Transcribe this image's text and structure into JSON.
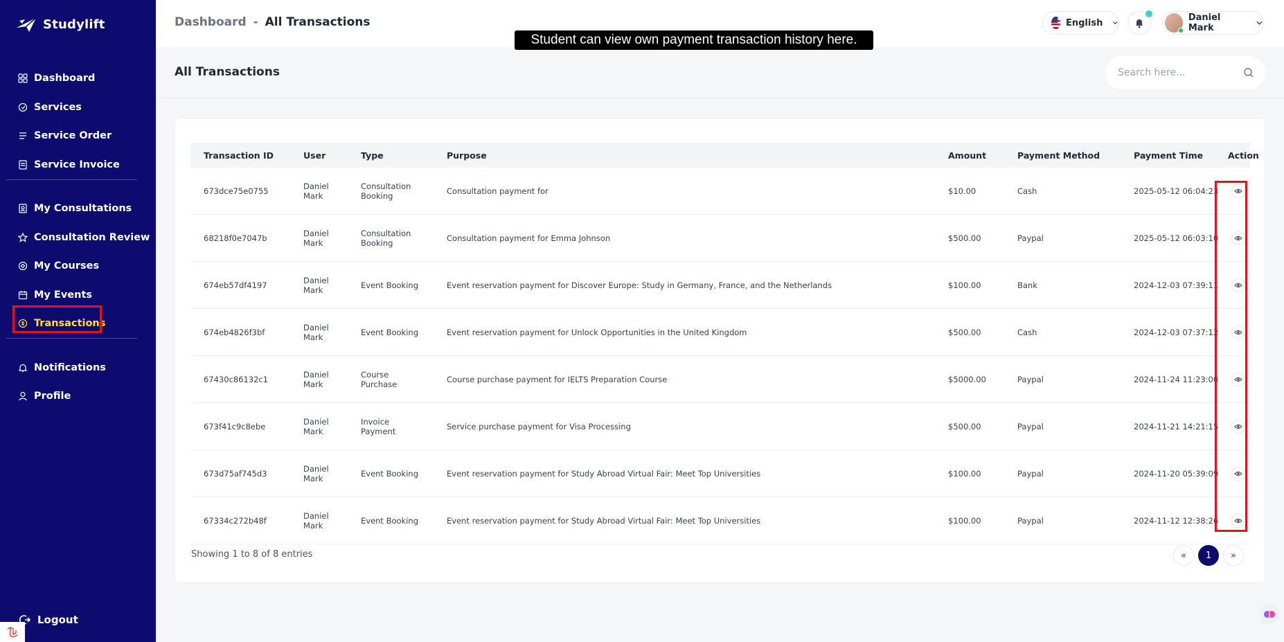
{
  "app": {
    "name": "Studylift"
  },
  "sidebar": {
    "items": [
      {
        "label": "Dashboard",
        "icon": "grid-icon"
      },
      {
        "label": "Services",
        "icon": "services-icon"
      },
      {
        "label": "Service Order",
        "icon": "list-icon"
      },
      {
        "label": "Service Invoice",
        "icon": "invoice-icon"
      },
      {
        "label": "My Consultations",
        "icon": "consultation-icon"
      },
      {
        "label": "Consultation Review",
        "icon": "star-icon"
      },
      {
        "label": "My Courses",
        "icon": "course-icon"
      },
      {
        "label": "My Events",
        "icon": "calendar-icon"
      },
      {
        "label": "Transactions",
        "icon": "transaction-icon",
        "active": true
      },
      {
        "label": "Notifications",
        "icon": "bell-icon"
      },
      {
        "label": "Profile",
        "icon": "user-icon"
      }
    ],
    "logout_label": "Logout",
    "active_color": "#ffdd33",
    "bg_color": "#0d0c6e"
  },
  "header": {
    "breadcrumb_root": "Dashboard",
    "breadcrumb_sep": "-",
    "breadcrumb_current": "All Transactions",
    "language": "English",
    "user_name": "Daniel Mark"
  },
  "tooltip": {
    "text": "Student can view own payment transaction history here."
  },
  "page": {
    "title": "All Transactions",
    "search_placeholder": "Search here..."
  },
  "table": {
    "columns": [
      "Transaction ID",
      "User",
      "Type",
      "Purpose",
      "Amount",
      "Payment Method",
      "Payment Time",
      "Action"
    ],
    "rows": [
      {
        "id": "673dce75e0755",
        "user": [
          "Daniel",
          "Mark"
        ],
        "type": [
          "Consultation",
          "Booking"
        ],
        "purpose": "Consultation payment for",
        "amount": "$10.00",
        "method": "Cash",
        "time": "2025-05-12 06:04:23"
      },
      {
        "id": "68218f0e7047b",
        "user": [
          "Daniel",
          "Mark"
        ],
        "type": [
          "Consultation",
          "Booking"
        ],
        "purpose": "Consultation payment for Emma Johnson",
        "amount": "$500.00",
        "method": "Paypal",
        "time": "2025-05-12 06:03:10"
      },
      {
        "id": "674eb57df4197",
        "user": [
          "Daniel",
          "Mark"
        ],
        "type": [
          "Event Booking",
          ""
        ],
        "purpose": "Event reservation payment for Discover Europe: Study in Germany, France, and the Netherlands",
        "amount": "$100.00",
        "method": "Bank",
        "time": "2024-12-03 07:39:11"
      },
      {
        "id": "674eb4826f3bf",
        "user": [
          "Daniel",
          "Mark"
        ],
        "type": [
          "Event Booking",
          ""
        ],
        "purpose": "Event reservation payment for Unlock Opportunities in the United Kingdom",
        "amount": "$500.00",
        "method": "Cash",
        "time": "2024-12-03 07:37:12"
      },
      {
        "id": "67430c86132c1",
        "user": [
          "Daniel",
          "Mark"
        ],
        "type": [
          "Course",
          "Purchase"
        ],
        "purpose": "Course purchase payment for IELTS Preparation Course",
        "amount": "$5000.00",
        "method": "Paypal",
        "time": "2024-11-24 11:23:00"
      },
      {
        "id": "673f41c9c8ebe",
        "user": [
          "Daniel",
          "Mark"
        ],
        "type": [
          "Invoice",
          "Payment"
        ],
        "purpose": "Service purchase payment for Visa Processing",
        "amount": "$500.00",
        "method": "Paypal",
        "time": "2024-11-21 14:21:15"
      },
      {
        "id": "673d75af745d3",
        "user": [
          "Daniel",
          "Mark"
        ],
        "type": [
          "Event Booking",
          ""
        ],
        "purpose": "Event reservation payment for Study Abroad Virtual Fair: Meet Top Universities",
        "amount": "$100.00",
        "method": "Paypal",
        "time": "2024-11-20 05:39:09"
      },
      {
        "id": "67334c272b48f",
        "user": [
          "Daniel",
          "Mark"
        ],
        "type": [
          "Event Booking",
          ""
        ],
        "purpose": "Event reservation payment for Study Abroad Virtual Fair: Meet Top Universities",
        "amount": "$100.00",
        "method": "Paypal",
        "time": "2024-11-12 12:38:26"
      }
    ],
    "action_icon": "eye-icon"
  },
  "pagination": {
    "summary": "Showing 1 to 8 of 8 entries",
    "prev": "«",
    "current": "1",
    "next": "»"
  },
  "highlight_color": "#e0141e"
}
